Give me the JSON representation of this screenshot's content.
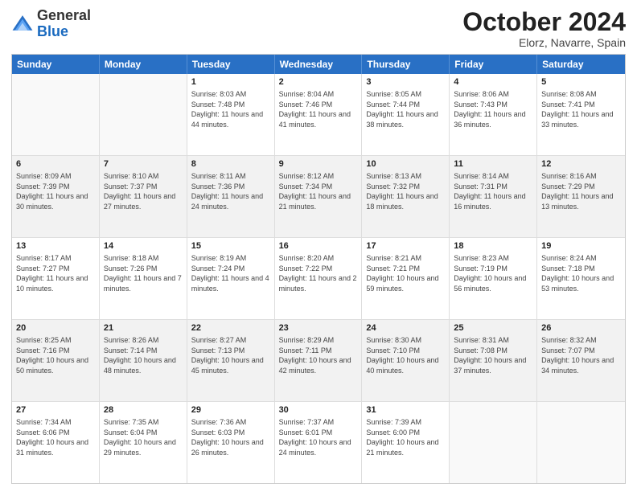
{
  "logo": {
    "general": "General",
    "blue": "Blue"
  },
  "header": {
    "month": "October 2024",
    "location": "Elorz, Navarre, Spain"
  },
  "weekdays": [
    "Sunday",
    "Monday",
    "Tuesday",
    "Wednesday",
    "Thursday",
    "Friday",
    "Saturday"
  ],
  "rows": [
    [
      {
        "day": "",
        "sunrise": "",
        "sunset": "",
        "daylight": "",
        "empty": true
      },
      {
        "day": "",
        "sunrise": "",
        "sunset": "",
        "daylight": "",
        "empty": true
      },
      {
        "day": "1",
        "sunrise": "Sunrise: 8:03 AM",
        "sunset": "Sunset: 7:48 PM",
        "daylight": "Daylight: 11 hours and 44 minutes."
      },
      {
        "day": "2",
        "sunrise": "Sunrise: 8:04 AM",
        "sunset": "Sunset: 7:46 PM",
        "daylight": "Daylight: 11 hours and 41 minutes."
      },
      {
        "day": "3",
        "sunrise": "Sunrise: 8:05 AM",
        "sunset": "Sunset: 7:44 PM",
        "daylight": "Daylight: 11 hours and 38 minutes."
      },
      {
        "day": "4",
        "sunrise": "Sunrise: 8:06 AM",
        "sunset": "Sunset: 7:43 PM",
        "daylight": "Daylight: 11 hours and 36 minutes."
      },
      {
        "day": "5",
        "sunrise": "Sunrise: 8:08 AM",
        "sunset": "Sunset: 7:41 PM",
        "daylight": "Daylight: 11 hours and 33 minutes."
      }
    ],
    [
      {
        "day": "6",
        "sunrise": "Sunrise: 8:09 AM",
        "sunset": "Sunset: 7:39 PM",
        "daylight": "Daylight: 11 hours and 30 minutes."
      },
      {
        "day": "7",
        "sunrise": "Sunrise: 8:10 AM",
        "sunset": "Sunset: 7:37 PM",
        "daylight": "Daylight: 11 hours and 27 minutes."
      },
      {
        "day": "8",
        "sunrise": "Sunrise: 8:11 AM",
        "sunset": "Sunset: 7:36 PM",
        "daylight": "Daylight: 11 hours and 24 minutes."
      },
      {
        "day": "9",
        "sunrise": "Sunrise: 8:12 AM",
        "sunset": "Sunset: 7:34 PM",
        "daylight": "Daylight: 11 hours and 21 minutes."
      },
      {
        "day": "10",
        "sunrise": "Sunrise: 8:13 AM",
        "sunset": "Sunset: 7:32 PM",
        "daylight": "Daylight: 11 hours and 18 minutes."
      },
      {
        "day": "11",
        "sunrise": "Sunrise: 8:14 AM",
        "sunset": "Sunset: 7:31 PM",
        "daylight": "Daylight: 11 hours and 16 minutes."
      },
      {
        "day": "12",
        "sunrise": "Sunrise: 8:16 AM",
        "sunset": "Sunset: 7:29 PM",
        "daylight": "Daylight: 11 hours and 13 minutes."
      }
    ],
    [
      {
        "day": "13",
        "sunrise": "Sunrise: 8:17 AM",
        "sunset": "Sunset: 7:27 PM",
        "daylight": "Daylight: 11 hours and 10 minutes."
      },
      {
        "day": "14",
        "sunrise": "Sunrise: 8:18 AM",
        "sunset": "Sunset: 7:26 PM",
        "daylight": "Daylight: 11 hours and 7 minutes."
      },
      {
        "day": "15",
        "sunrise": "Sunrise: 8:19 AM",
        "sunset": "Sunset: 7:24 PM",
        "daylight": "Daylight: 11 hours and 4 minutes."
      },
      {
        "day": "16",
        "sunrise": "Sunrise: 8:20 AM",
        "sunset": "Sunset: 7:22 PM",
        "daylight": "Daylight: 11 hours and 2 minutes."
      },
      {
        "day": "17",
        "sunrise": "Sunrise: 8:21 AM",
        "sunset": "Sunset: 7:21 PM",
        "daylight": "Daylight: 10 hours and 59 minutes."
      },
      {
        "day": "18",
        "sunrise": "Sunrise: 8:23 AM",
        "sunset": "Sunset: 7:19 PM",
        "daylight": "Daylight: 10 hours and 56 minutes."
      },
      {
        "day": "19",
        "sunrise": "Sunrise: 8:24 AM",
        "sunset": "Sunset: 7:18 PM",
        "daylight": "Daylight: 10 hours and 53 minutes."
      }
    ],
    [
      {
        "day": "20",
        "sunrise": "Sunrise: 8:25 AM",
        "sunset": "Sunset: 7:16 PM",
        "daylight": "Daylight: 10 hours and 50 minutes."
      },
      {
        "day": "21",
        "sunrise": "Sunrise: 8:26 AM",
        "sunset": "Sunset: 7:14 PM",
        "daylight": "Daylight: 10 hours and 48 minutes."
      },
      {
        "day": "22",
        "sunrise": "Sunrise: 8:27 AM",
        "sunset": "Sunset: 7:13 PM",
        "daylight": "Daylight: 10 hours and 45 minutes."
      },
      {
        "day": "23",
        "sunrise": "Sunrise: 8:29 AM",
        "sunset": "Sunset: 7:11 PM",
        "daylight": "Daylight: 10 hours and 42 minutes."
      },
      {
        "day": "24",
        "sunrise": "Sunrise: 8:30 AM",
        "sunset": "Sunset: 7:10 PM",
        "daylight": "Daylight: 10 hours and 40 minutes."
      },
      {
        "day": "25",
        "sunrise": "Sunrise: 8:31 AM",
        "sunset": "Sunset: 7:08 PM",
        "daylight": "Daylight: 10 hours and 37 minutes."
      },
      {
        "day": "26",
        "sunrise": "Sunrise: 8:32 AM",
        "sunset": "Sunset: 7:07 PM",
        "daylight": "Daylight: 10 hours and 34 minutes."
      }
    ],
    [
      {
        "day": "27",
        "sunrise": "Sunrise: 7:34 AM",
        "sunset": "Sunset: 6:06 PM",
        "daylight": "Daylight: 10 hours and 31 minutes."
      },
      {
        "day": "28",
        "sunrise": "Sunrise: 7:35 AM",
        "sunset": "Sunset: 6:04 PM",
        "daylight": "Daylight: 10 hours and 29 minutes."
      },
      {
        "day": "29",
        "sunrise": "Sunrise: 7:36 AM",
        "sunset": "Sunset: 6:03 PM",
        "daylight": "Daylight: 10 hours and 26 minutes."
      },
      {
        "day": "30",
        "sunrise": "Sunrise: 7:37 AM",
        "sunset": "Sunset: 6:01 PM",
        "daylight": "Daylight: 10 hours and 24 minutes."
      },
      {
        "day": "31",
        "sunrise": "Sunrise: 7:39 AM",
        "sunset": "Sunset: 6:00 PM",
        "daylight": "Daylight: 10 hours and 21 minutes."
      },
      {
        "day": "",
        "sunrise": "",
        "sunset": "",
        "daylight": "",
        "empty": true
      },
      {
        "day": "",
        "sunrise": "",
        "sunset": "",
        "daylight": "",
        "empty": true
      }
    ]
  ]
}
